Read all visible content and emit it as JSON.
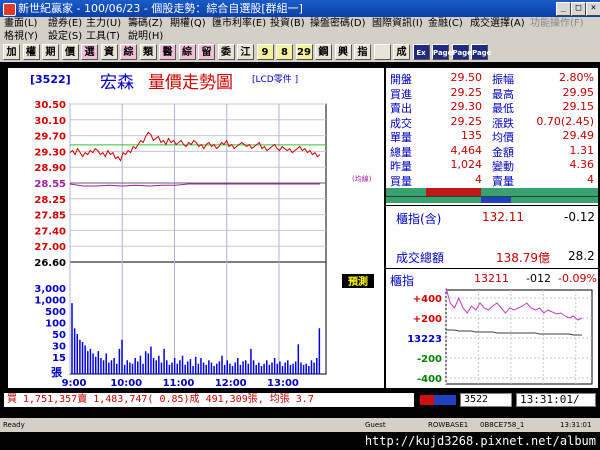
{
  "window": {
    "title": "新世紀贏家 - 100/06/23 - 個股走勢：綜合自選股[群組一]"
  },
  "menu_row1": [
    "畫面(L)",
    "證券(E)",
    "主力(U)",
    "籌碼(Z)",
    "期權(Q)",
    "匯市利率(E)",
    "投資(B)",
    "操盤密碼(D)",
    "國際資訊(I)",
    "金融(C)",
    "成交選擇(A)",
    "功能操作(F)"
  ],
  "menu_row2": [
    "格視(Y)",
    "設定(S)",
    "工具(T)",
    "說明(H)"
  ],
  "toolbar": [
    "加",
    "權",
    "期",
    "價",
    "選",
    "資",
    "綜",
    "類",
    "醫",
    "綜",
    "留",
    "委",
    "江",
    "9",
    "8",
    "29",
    "鋼",
    "興",
    "指",
    "",
    "成",
    "Ex",
    "Page",
    "Page",
    "Page"
  ],
  "stock": {
    "code": "[3522]",
    "name": "宏森",
    "chart_title": "量價走勢圖",
    "industry": "[LCD零件 ]"
  },
  "chart_data": {
    "type": "line",
    "price_ticks": [
      "30.50",
      "30.10",
      "29.70",
      "29.30",
      "28.90",
      "28.55",
      "28.25",
      "27.85",
      "27.40",
      "27.00",
      "26.60"
    ],
    "volume_ticks": [
      "3,000",
      "1,000",
      "500",
      "100",
      "50",
      "30",
      "15"
    ],
    "volume_unit": "張",
    "time_ticks": [
      "9:00",
      "10:00",
      "11:00",
      "12:00",
      "13:00"
    ],
    "prev_close": 28.55,
    "prev_close_label": "(均線)",
    "predict_label": "預測",
    "ylim": [
      26.6,
      30.5
    ],
    "series": [
      {
        "name": "price",
        "values": [
          29.3,
          29.35,
          29.25,
          29.4,
          29.3,
          29.2,
          29.3,
          29.25,
          29.35,
          29.3,
          29.4,
          29.35,
          29.25,
          29.3,
          29.2,
          29.35,
          29.25,
          29.3,
          29.15,
          29.2,
          29.1,
          29.3,
          29.25,
          29.35,
          29.3,
          29.45,
          29.4,
          29.5,
          29.6,
          29.55,
          29.7,
          29.8,
          29.75,
          29.6,
          29.65,
          29.7,
          29.55,
          29.6,
          29.5,
          29.65,
          29.55,
          29.6,
          29.5,
          29.55,
          29.6,
          29.5,
          29.45,
          29.55,
          29.5,
          29.6,
          29.55,
          29.45,
          29.5,
          29.4,
          29.5,
          29.55,
          29.45,
          29.5,
          29.4,
          29.45,
          29.55,
          29.5,
          29.6,
          29.45,
          29.5,
          29.4,
          29.45,
          29.5,
          29.55,
          29.5,
          29.45,
          29.5,
          29.4,
          29.45,
          29.5,
          29.55,
          29.4,
          29.45,
          29.35,
          29.4,
          29.45,
          29.5,
          29.4,
          29.35,
          29.45,
          29.4,
          29.35,
          29.4,
          29.3,
          29.35,
          29.4,
          29.45,
          29.35,
          29.4,
          29.3,
          29.35,
          29.25,
          29.3,
          29.2,
          29.25
        ]
      },
      {
        "name": "avg",
        "values": [
          28.55,
          28.5,
          28.5,
          28.52,
          28.5,
          28.52,
          28.5,
          28.52,
          28.52,
          28.55,
          28.55,
          28.55,
          28.55,
          28.55,
          28.55,
          28.55,
          28.55,
          28.55,
          28.55,
          28.55
        ]
      }
    ],
    "volume": [
      62,
      40,
      35,
      30,
      28,
      25,
      20,
      22,
      18,
      15,
      20,
      14,
      12,
      18,
      10,
      12,
      14,
      9,
      22,
      30,
      8,
      12,
      10,
      9,
      14,
      11,
      16,
      9,
      20,
      18,
      24,
      14,
      12,
      16,
      10,
      22,
      12,
      8,
      10,
      14,
      9,
      12,
      16,
      8,
      11,
      13,
      7,
      15,
      9,
      14,
      10,
      8,
      12,
      10,
      7,
      9,
      11,
      16,
      8,
      12,
      9,
      7,
      10,
      14,
      8,
      11,
      12,
      9,
      22,
      12,
      8,
      10,
      7,
      9,
      12,
      8,
      10,
      14,
      9,
      11,
      7,
      10,
      12,
      8,
      9,
      11,
      26,
      10,
      8,
      9,
      7,
      12,
      10,
      14,
      40
    ],
    "index": {
      "values": [
        0.5,
        0.35,
        0.3,
        0.4,
        0.3,
        0.25,
        0.32,
        0.28,
        0.35,
        0.3,
        0.28,
        0.32,
        0.35,
        0.3,
        0.25,
        0.3,
        0.28,
        0.3,
        0.32,
        0.35,
        0.3,
        0.28,
        0.3,
        0.25,
        0.28,
        0.26,
        0.24,
        0.25,
        0.22,
        0.2,
        0.22,
        0.18,
        0.2
      ],
      "avg": [
        0.28,
        0.28,
        0.28,
        0.27,
        0.27,
        0.27,
        0.27,
        0.26,
        0.26,
        0.26,
        0.26,
        0.26,
        0.25,
        0.25,
        0.25,
        0.25,
        0.25,
        0.25,
        0.25,
        0.25,
        0.25,
        0.25,
        0.24,
        0.24,
        0.24,
        0.24,
        0.24,
        0.24,
        0.24,
        0.24,
        0.23,
        0.23,
        0.23
      ]
    },
    "index_ticks": [
      "+400",
      "+200",
      "13223",
      "-200",
      "-400"
    ]
  },
  "quote": {
    "rows": [
      {
        "l1": "開盤",
        "v1": "29.50",
        "l2": "振幅",
        "v2": "2.80%"
      },
      {
        "l1": "買進",
        "v1": "29.25",
        "l2": "最高",
        "v2": "29.95"
      },
      {
        "l1": "賣出",
        "v1": "29.30",
        "l2": "最低",
        "v2": "29.15"
      },
      {
        "l1": "成交",
        "v1": "29.25",
        "l2": "漲跌",
        "v2": "0.70(2.45)"
      },
      {
        "l1": "單量",
        "v1": "135",
        "l2": "均價",
        "v2": "29.49"
      },
      {
        "l1": "總量",
        "v1": "4,464",
        "l2": "金額",
        "v2": "1.31"
      },
      {
        "l1": "昨量",
        "v1": "1,024",
        "l2": "變動",
        "v2": "4.36"
      },
      {
        "l1": "買量",
        "v1": "4",
        "l2": "賣量",
        "v2": "4"
      }
    ]
  },
  "market": {
    "index_label": "櫃指(含)",
    "index_value": "132.11",
    "index_change": "-0.12",
    "turnover_label": "成交總額",
    "turnover_value": "138.79億",
    "turnover_extra": "28.2"
  },
  "otc": {
    "label": "櫃指",
    "value": "13211",
    "change": "-012",
    "pct": "-0.09%"
  },
  "bottom": {
    "summary": "買 1,751,357賣 1,483,747( 0.85)成 491,309張, 均張 3.7",
    "code_box": "3522",
    "time": "13:31:01/"
  },
  "statusbar": {
    "ready": "Ready",
    "guest": "Guest",
    "server": "ROWBASE1",
    "session": "0B8CE758_1",
    "time": "13:31:01"
  },
  "url": "http://kujd3268.pixnet.net/album",
  "colors": {
    "price": "#d00000",
    "avg": "#a020a0",
    "volume": "#0000e0",
    "up": "#d00000",
    "down": "#008000",
    "label": "#0000c0"
  }
}
